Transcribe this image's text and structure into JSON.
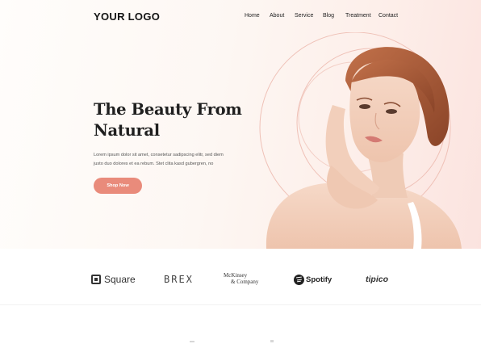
{
  "header": {
    "logo": "YOUR LOGO",
    "nav": [
      "Home",
      "About",
      "Service",
      "Blog",
      "Treatment",
      "Contact"
    ]
  },
  "hero": {
    "headline_line1": "The Beauty From",
    "headline_line2": "Natural",
    "subtext_line1": "Lorem ipsum dolor sit amet, consetetur sadipscing elitr, sed diem",
    "subtext_line2": "justo duo dolores et ea rebum. Stet clita kasd gubergren, no",
    "cta_label": "Shop Now"
  },
  "brands": {
    "square": "Square",
    "brex": "BREX",
    "mckinsey_line1": "McKinsey",
    "mckinsey_line2": "& Company",
    "spotify": "Spotify",
    "tipico": "tipico"
  },
  "colors": {
    "accent": "#e98b7b",
    "hero_tint": "#fbe3df",
    "ring": "#efc1b7"
  }
}
